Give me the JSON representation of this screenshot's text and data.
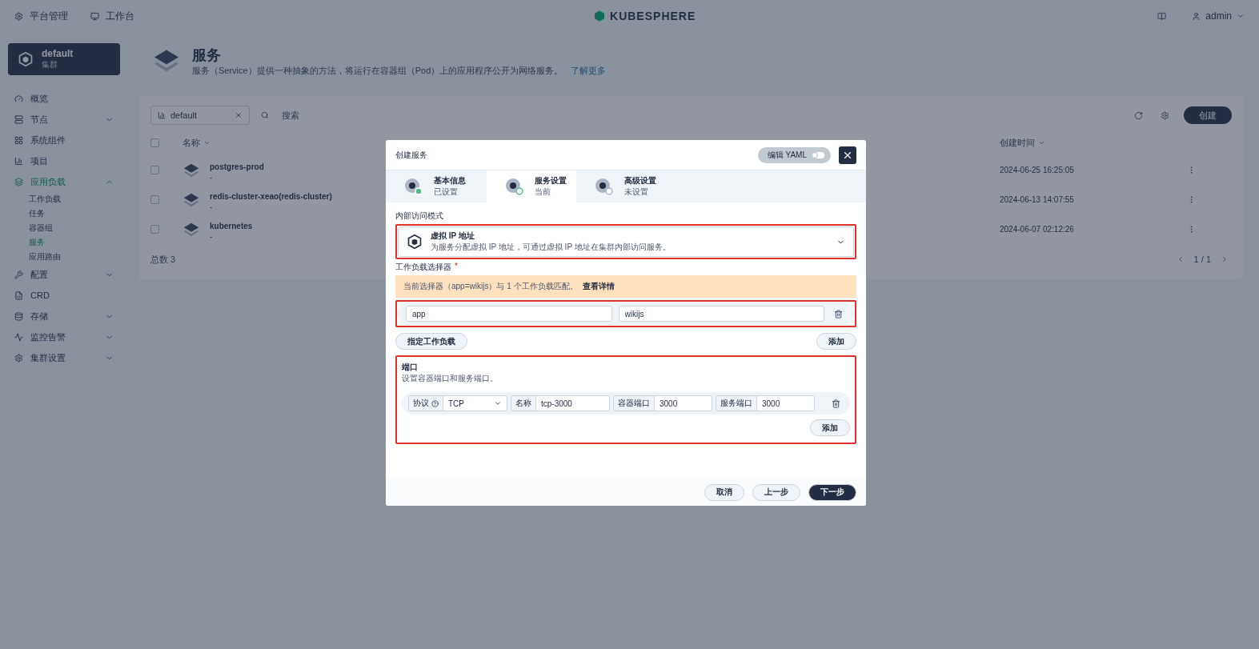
{
  "top_nav": {
    "items": [
      {
        "label": "平台管理",
        "kind": "platform"
      },
      {
        "label": "工作台",
        "kind": "workbench"
      }
    ],
    "logo": "KUBESPHERE",
    "user": "admin"
  },
  "sidebar": {
    "cluster": {
      "name": "default",
      "type": "集群"
    },
    "items": [
      {
        "label": "概览",
        "kind": "overview",
        "expandable": false,
        "expanded": false,
        "selected": false
      },
      {
        "label": "节点",
        "kind": "nodes",
        "expandable": true,
        "expanded": false,
        "selected": false
      },
      {
        "label": "系统组件",
        "kind": "components",
        "expandable": false,
        "expanded": false,
        "selected": false
      },
      {
        "label": "项目",
        "kind": "projects",
        "expandable": false,
        "expanded": false,
        "selected": false
      },
      {
        "label": "应用负载",
        "kind": "workloads",
        "expandable": true,
        "expanded": true,
        "selected": true,
        "children": [
          {
            "label": "工作负载",
            "selected": false
          },
          {
            "label": "任务",
            "selected": false
          },
          {
            "label": "容器组",
            "selected": false
          },
          {
            "label": "服务",
            "selected": true
          },
          {
            "label": "应用路由",
            "selected": false
          }
        ]
      },
      {
        "label": "配置",
        "kind": "config",
        "expandable": true,
        "expanded": false,
        "selected": false
      },
      {
        "label": "CRD",
        "kind": "crd",
        "expandable": false,
        "expanded": false,
        "selected": false
      },
      {
        "label": "存储",
        "kind": "storage",
        "expandable": true,
        "expanded": false,
        "selected": false
      },
      {
        "label": "监控告警",
        "kind": "monitoring",
        "expandable": true,
        "expanded": false,
        "selected": false
      },
      {
        "label": "集群设置",
        "kind": "settings",
        "expandable": true,
        "expanded": false,
        "selected": false
      }
    ]
  },
  "page_header": {
    "title": "服务",
    "description": "服务（Service）提供一种抽象的方法，将运行在容器组（Pod）上的应用程序公开为网络服务。",
    "link": "了解更多"
  },
  "toolbar": {
    "filter_tag": "default",
    "search_placeholder": "搜索",
    "create_button": "创建"
  },
  "table": {
    "columns": [
      "名称",
      "创建时间"
    ],
    "select_all_checked": false,
    "rows": [
      {
        "name": "postgres-prod",
        "sub": "-",
        "created": "2024-06-25 16:25:05",
        "checked": false
      },
      {
        "name": "redis-cluster-xeao(redis-cluster)",
        "sub": "-",
        "created": "2024-06-13 14:07:55",
        "checked": false
      },
      {
        "name": "kubernetes",
        "sub": "-",
        "created": "2024-06-07 02:12:26",
        "checked": false
      }
    ],
    "total_label": "总数",
    "total": "3",
    "pagination": "1 / 1"
  },
  "modal": {
    "title": "创建服务",
    "yaml_toggle": {
      "label": "编辑 YAML",
      "on": false
    },
    "steps": [
      {
        "title": "基本信息",
        "status": "已设置",
        "completed": true,
        "selected": false
      },
      {
        "title": "服务设置",
        "status": "当前",
        "completed": false,
        "selected": true
      },
      {
        "title": "高级设置",
        "status": "未设置",
        "completed": false,
        "selected": false
      }
    ],
    "access_mode": {
      "label": "内部访问模式",
      "title": "虚拟 IP 地址",
      "description": "为服务分配虚拟 IP 地址，可通过虚拟 IP 地址在集群内部访问服务。"
    },
    "selector": {
      "label": "工作负载选择器",
      "required_mark": "*",
      "notice": "当前选择器（app=wikijs）与 1 个工作负载匹配。",
      "notice_link": "查看详情",
      "rows": [
        {
          "key": "app",
          "value": "wikijs"
        }
      ],
      "specify_button": "指定工作负载",
      "add_button": "添加"
    },
    "ports": {
      "title": "端口",
      "description": "设置容器端口和服务端口。",
      "rows": [
        {
          "protocol_label": "协议",
          "protocol": "TCP",
          "name_label": "名称",
          "name": "tcp-3000",
          "container_port_label": "容器端口",
          "container_port": "3000",
          "service_port_label": "服务端口",
          "service_port": "3000"
        }
      ],
      "add_button": "添加"
    },
    "footer": [
      {
        "label": "取消",
        "kind": "default"
      },
      {
        "label": "上一步",
        "kind": "default"
      },
      {
        "label": "下一步",
        "kind": "primary"
      }
    ]
  }
}
